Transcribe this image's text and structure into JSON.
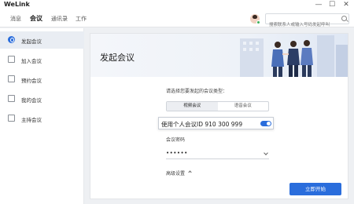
{
  "app": {
    "name": "WeLink"
  },
  "window": {
    "minimize": "—",
    "maximize": "☐",
    "close": "✕"
  },
  "nav": {
    "tabs": [
      {
        "label": "消息"
      },
      {
        "label": "会议"
      },
      {
        "label": "通讯录"
      },
      {
        "label": "工作"
      }
    ],
    "active_tab": "会议",
    "search_placeholder": "搜索联系人或输入号码发起呼叫"
  },
  "sidebar": {
    "items": [
      {
        "label": "发起会议",
        "icon": "video-meeting-icon"
      },
      {
        "label": "加入会议",
        "icon": "join-meeting-icon"
      },
      {
        "label": "预约会议",
        "icon": "schedule-meeting-icon"
      },
      {
        "label": "我的会议",
        "icon": "my-meetings-icon"
      },
      {
        "label": "主持会议",
        "icon": "host-meeting-icon"
      }
    ],
    "active_index": 0
  },
  "main": {
    "banner_title": "发起会议",
    "type_prompt": "请选择您要发起的会议类型：",
    "types": [
      {
        "label": "视频会议"
      },
      {
        "label": "语音会议"
      }
    ],
    "active_type_index": 0,
    "personal_id_label": "使用个人会议ID 910 300 999",
    "personal_id_enabled": true,
    "password_label": "会议密码",
    "password_value": "••••••",
    "advanced_label": "高级设置",
    "start_button": "立即开始"
  },
  "colors": {
    "accent": "#2a6ddc",
    "online": "#3bb15a"
  }
}
